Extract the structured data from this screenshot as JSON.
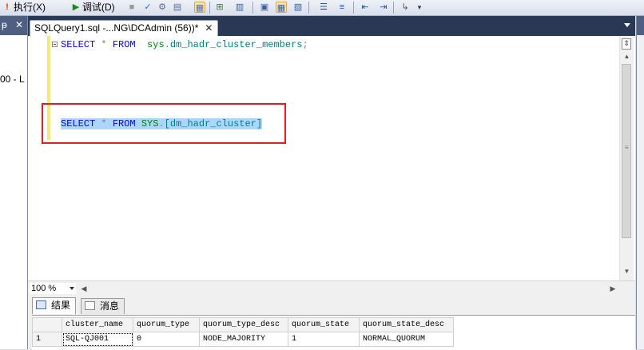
{
  "toolbar": {
    "execute_label": "执行(X)",
    "debug_label": "调试(D)"
  },
  "left_panel": {
    "pin_glyph": "ᵽ",
    "close_glyph": "✕",
    "tree_text": "00 - L"
  },
  "document_tab": {
    "title": "SQLQuery1.sql -...NG\\DCAdmin (56))*",
    "close_glyph": "✕"
  },
  "editor": {
    "line1": {
      "keyword1": "SELECT",
      "operator": "*",
      "keyword2": "FROM",
      "schema": "sys",
      "dot": ".",
      "object": "dm_hadr_cluster_members",
      "terminator": ";"
    },
    "line2": {
      "keyword1": "SELECT",
      "operator": "*",
      "keyword2": "FROM",
      "schema": "SYS",
      "dot": ".",
      "object": "[dm_hadr_cluster]"
    }
  },
  "zoom": {
    "value": "100 %"
  },
  "results": {
    "tabs": [
      "结果",
      "消息"
    ],
    "columns": [
      "cluster_name",
      "quorum_type",
      "quorum_type_desc",
      "quorum_state",
      "quorum_state_desc"
    ],
    "rows": [
      {
        "row_number": "1",
        "cells": [
          "SQL-QJ001",
          "0",
          "NODE_MAJORITY",
          "1",
          "NORMAL_QUORUM"
        ]
      }
    ]
  },
  "colors": {
    "keyword": "#0000ff",
    "system_schema": "#008000",
    "system_object": "#008080",
    "selection": "#add6ff",
    "highlight_box": "#e02020",
    "tab_strip": "#293955"
  }
}
